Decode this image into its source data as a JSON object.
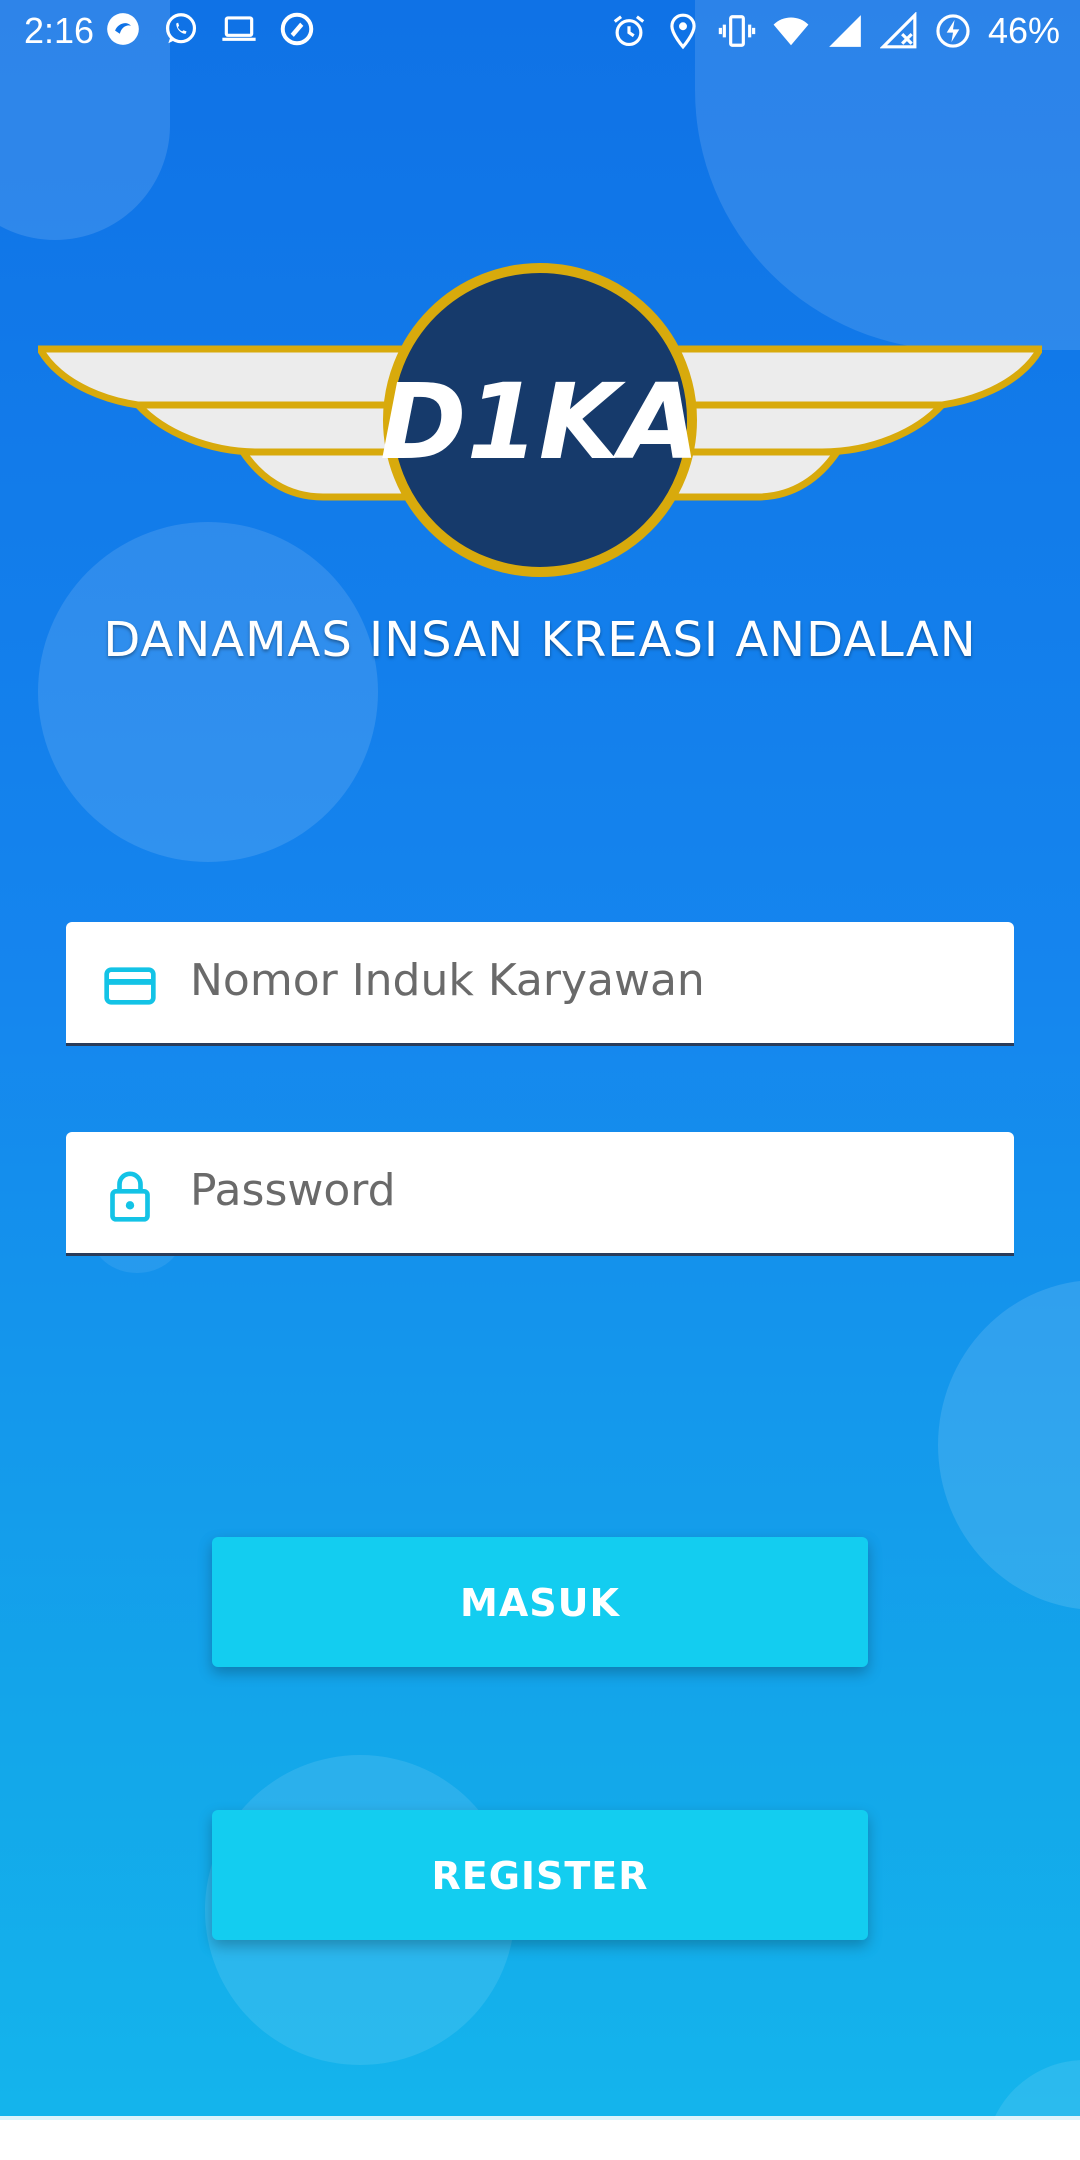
{
  "status_bar": {
    "time": "2:16",
    "battery_percent": "46%",
    "left_icons": [
      "browser-app-icon",
      "whatsapp-icon",
      "laptop-icon",
      "sync-app-icon"
    ],
    "right_icons": [
      "alarm-icon",
      "location-icon",
      "vibrate-icon",
      "wifi-icon",
      "signal-icon",
      "no-signal-icon",
      "battery-charging-icon"
    ]
  },
  "logo": {
    "text": "D1KA",
    "colors": {
      "circle": "#163a6b",
      "ring": "#d8aa0c",
      "wings": "#ececec"
    }
  },
  "company_name": "DANAMAS INSAN KREASI ANDALAN",
  "form": {
    "nik": {
      "placeholder": "Nomor Induk Karyawan",
      "value": "",
      "icon": "card-icon"
    },
    "password": {
      "placeholder": "Password",
      "value": "",
      "icon": "lock-icon"
    }
  },
  "buttons": {
    "login_label": "MASUK",
    "register_label": "REGISTER"
  },
  "colors": {
    "background_top": "#0f72e6",
    "background_bottom": "#14b6ec",
    "button": "#13cdf0",
    "icon_accent": "#13c3e6"
  }
}
